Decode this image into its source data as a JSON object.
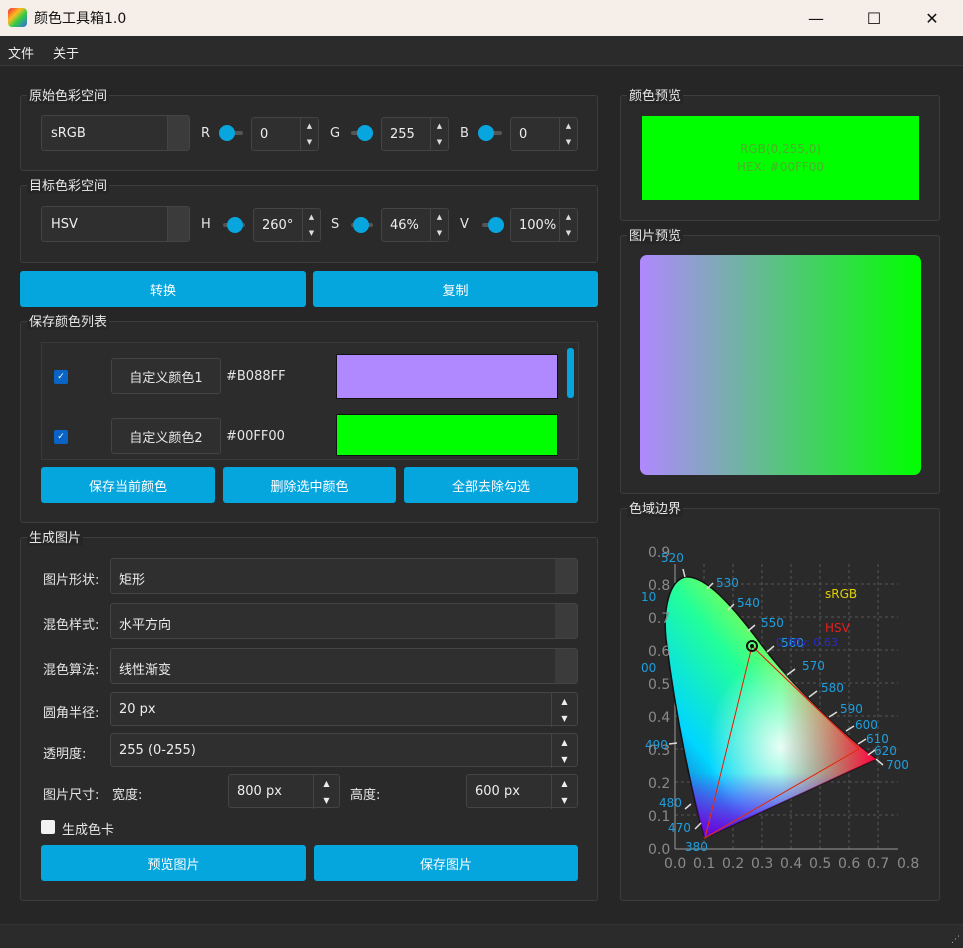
{
  "window": {
    "title": "颜色工具箱1.0",
    "minimize": "—",
    "maximize": "☐",
    "close": "✕"
  },
  "menu": {
    "file": "文件",
    "about": "关于"
  },
  "source_space": {
    "title": "原始色彩空间",
    "space": "sRGB",
    "ch1": {
      "label": "R",
      "value": "0",
      "level": 0
    },
    "ch2": {
      "label": "G",
      "value": "255",
      "level": 1
    },
    "ch3": {
      "label": "B",
      "value": "0",
      "level": 0
    }
  },
  "target_space": {
    "title": "目标色彩空间",
    "space": "HSV",
    "ch1": {
      "label": "H",
      "value": "260°",
      "level": 0.72
    },
    "ch2": {
      "label": "S",
      "value": "46%",
      "level": 0.46
    },
    "ch3": {
      "label": "V",
      "value": "100%",
      "level": 1
    }
  },
  "actions": {
    "convert": "转换",
    "copy": "复制"
  },
  "saved_colors": {
    "title": "保存颜色列表",
    "items": [
      {
        "name": "自定义颜色1",
        "hex": "#B088FF",
        "checked": true,
        "color": "#B088FF"
      },
      {
        "name": "自定义颜色2",
        "hex": "#00FF00",
        "checked": true,
        "color": "#00FF00"
      }
    ],
    "save_current": "保存当前颜色",
    "delete_selected": "删除选中颜色",
    "uncheck_all": "全部去除勾选"
  },
  "generate": {
    "title": "生成图片",
    "shape_label": "图片形状:",
    "shape_value": "矩形",
    "blend_style_label": "混色样式:",
    "blend_style_value": "水平方向",
    "blend_algo_label": "混色算法:",
    "blend_algo_value": "线性渐变",
    "radius_label": "圆角半径:",
    "radius_value": "20 px",
    "opacity_label": "透明度:",
    "opacity_value": "255 (0-255)",
    "size_label": "图片尺寸:",
    "width_label": "宽度:",
    "width_value": "800 px",
    "height_label": "高度:",
    "height_value": "600 px",
    "card_label": "生成色卡",
    "preview_btn": "预览图片",
    "save_btn": "保存图片"
  },
  "color_preview": {
    "title": "颜色预览",
    "rgb_text": "RGB(0,255,0)",
    "hex_text": "HEX: #00FF00",
    "color": "#00FF00"
  },
  "image_preview": {
    "title": "图片预览",
    "from": "#B088FF",
    "to": "#00FF00"
  },
  "gamut": {
    "title": "色域边界",
    "legend_srgb": "sRGB",
    "legend_hsv": "HSV",
    "coord_label": "0.30y: 0.63",
    "wavelengths": [
      "520",
      "530",
      "540",
      "550",
      "560",
      "570",
      "580",
      "590",
      "600",
      "610",
      "620",
      "700",
      "490",
      "480",
      "470",
      "380",
      "10",
      "00"
    ],
    "x_ticks": [
      "0.0",
      "0.1",
      "0.2",
      "0.3",
      "0.4",
      "0.5",
      "0.6",
      "0.7",
      "0.8"
    ],
    "y_ticks": [
      "0.0",
      "0.1",
      "0.2",
      "0.3",
      "0.4",
      "0.5",
      "0.6",
      "0.7",
      "0.8",
      "0.9"
    ]
  }
}
